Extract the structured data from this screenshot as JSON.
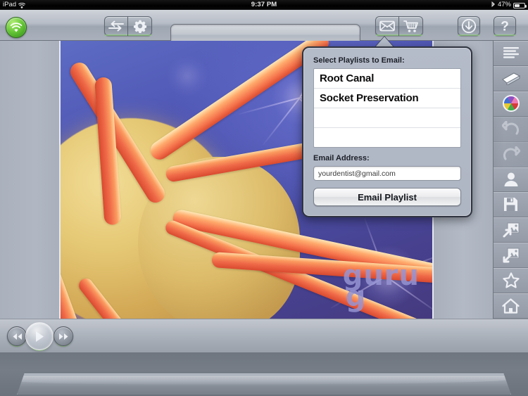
{
  "status_bar": {
    "carrier": "iPad",
    "wifi_icon": "wifi-icon",
    "time": "9:37 PM",
    "bluetooth_icon": "bluetooth-icon",
    "battery_percent": "47%",
    "battery_level": 47
  },
  "toolbar": {
    "wifi_status_button": "wifi-status-icon",
    "swap_button": "swap-arrows-icon",
    "settings_button": "gear-icon",
    "search": {
      "value": "",
      "placeholder": ""
    },
    "email_button": "envelope-icon",
    "cart_button": "shopping-cart-icon",
    "download_button": "download-arrow-icon",
    "help_button": "question-mark-icon"
  },
  "sidebar": {
    "items": [
      {
        "name": "sidebar-item-list",
        "icon": "list-lines-icon",
        "enabled": true
      },
      {
        "name": "sidebar-item-eraser",
        "icon": "eraser-icon",
        "enabled": true
      },
      {
        "name": "sidebar-item-colors",
        "icon": "color-wheel-icon",
        "enabled": true
      },
      {
        "name": "sidebar-item-undo",
        "icon": "undo-arrow-icon",
        "enabled": false
      },
      {
        "name": "sidebar-item-redo",
        "icon": "redo-arrow-icon",
        "enabled": false
      },
      {
        "name": "sidebar-item-patient",
        "icon": "person-icon",
        "enabled": true
      },
      {
        "name": "sidebar-item-save",
        "icon": "floppy-disk-icon",
        "enabled": true
      },
      {
        "name": "sidebar-item-image-out",
        "icon": "image-export-icon",
        "enabled": true
      },
      {
        "name": "sidebar-item-image-in",
        "icon": "image-import-icon",
        "enabled": true
      },
      {
        "name": "sidebar-item-favorite",
        "icon": "star-icon",
        "enabled": true
      },
      {
        "name": "sidebar-item-home",
        "icon": "home-icon",
        "enabled": true
      }
    ]
  },
  "stage": {
    "media_watermark_line1": "guru",
    "media_watermark_line2": "g"
  },
  "transport": {
    "previous_button": "rewind-icon",
    "play_button": "play-icon",
    "next_button": "fast-forward-icon"
  },
  "popover": {
    "title": "Select Playlists to Email:",
    "playlists": [
      {
        "label": "Root Canal"
      },
      {
        "label": "Socket Preservation"
      },
      {
        "label": ""
      },
      {
        "label": ""
      }
    ],
    "email_label": "Email Address:",
    "email_value": "yourdentist@gmail.com",
    "email_placeholder": "Email Address",
    "submit_label": "Email Playlist"
  },
  "colors": {
    "accent_green": "#68c838",
    "chrome": "#a9b0bc",
    "popover_bg": "#b4bbc9",
    "stage_blue": "#4f56b4",
    "dendrite_orange": "#ef6a48"
  }
}
